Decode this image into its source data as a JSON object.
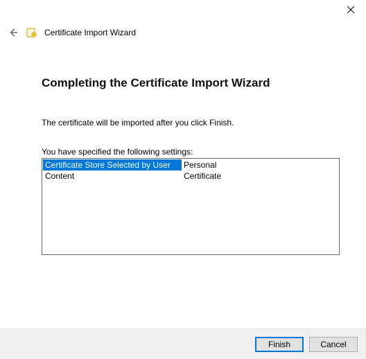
{
  "window": {
    "title": "Certificate Import Wizard"
  },
  "page": {
    "heading": "Completing the Certificate Import Wizard",
    "instruction": "The certificate will be imported after you click Finish.",
    "settings_label": "You have specified the following settings:",
    "rows": [
      {
        "key": "Certificate Store Selected by User",
        "value": "Personal"
      },
      {
        "key": "Content",
        "value": "Certificate"
      }
    ]
  },
  "footer": {
    "finish": "Finish",
    "cancel": "Cancel"
  }
}
